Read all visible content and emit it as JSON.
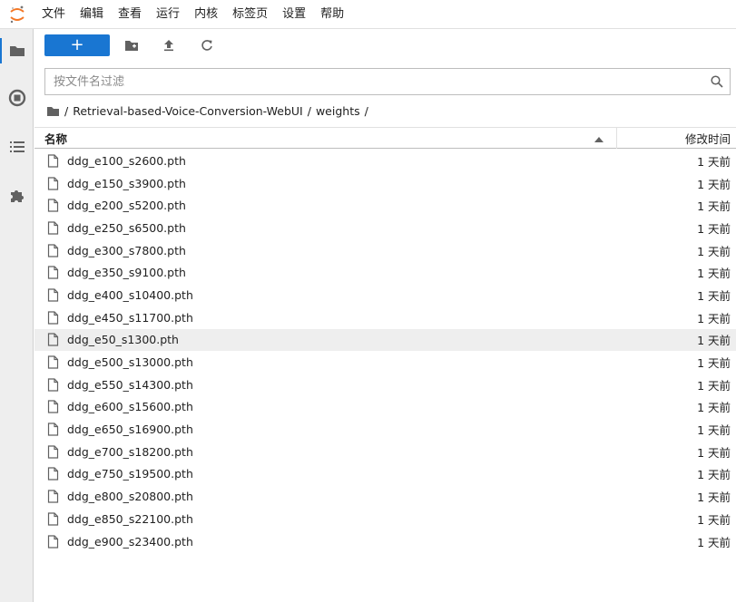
{
  "menu": {
    "items": [
      "文件",
      "编辑",
      "查看",
      "运行",
      "内核",
      "标签页",
      "设置",
      "帮助"
    ]
  },
  "sidebar": {
    "icons": [
      "folder-icon",
      "running-icon",
      "toc-icon",
      "extensions-icon"
    ]
  },
  "toolbar": {
    "new_label": "+"
  },
  "filter": {
    "placeholder": "按文件名过滤",
    "value": ""
  },
  "breadcrumb": {
    "parts": [
      "Retrieval-based-Voice-Conversion-WebUI",
      "weights"
    ]
  },
  "columns": {
    "name": "名称",
    "modified": "修改时间"
  },
  "files": [
    {
      "name": "ddg_e100_s2600.pth",
      "modified": "1 天前"
    },
    {
      "name": "ddg_e150_s3900.pth",
      "modified": "1 天前"
    },
    {
      "name": "ddg_e200_s5200.pth",
      "modified": "1 天前"
    },
    {
      "name": "ddg_e250_s6500.pth",
      "modified": "1 天前"
    },
    {
      "name": "ddg_e300_s7800.pth",
      "modified": "1 天前"
    },
    {
      "name": "ddg_e350_s9100.pth",
      "modified": "1 天前"
    },
    {
      "name": "ddg_e400_s10400.pth",
      "modified": "1 天前"
    },
    {
      "name": "ddg_e450_s11700.pth",
      "modified": "1 天前"
    },
    {
      "name": "ddg_e50_s1300.pth",
      "modified": "1 天前",
      "selected": true
    },
    {
      "name": "ddg_e500_s13000.pth",
      "modified": "1 天前"
    },
    {
      "name": "ddg_e550_s14300.pth",
      "modified": "1 天前"
    },
    {
      "name": "ddg_e600_s15600.pth",
      "modified": "1 天前"
    },
    {
      "name": "ddg_e650_s16900.pth",
      "modified": "1 天前"
    },
    {
      "name": "ddg_e700_s18200.pth",
      "modified": "1 天前"
    },
    {
      "name": "ddg_e750_s19500.pth",
      "modified": "1 天前"
    },
    {
      "name": "ddg_e800_s20800.pth",
      "modified": "1 天前"
    },
    {
      "name": "ddg_e850_s22100.pth",
      "modified": "1 天前"
    },
    {
      "name": "ddg_e900_s23400.pth",
      "modified": "1 天前"
    }
  ],
  "colors": {
    "accent": "#1976d2",
    "logo": "#f37726",
    "selected_row": "#eeeeee"
  }
}
